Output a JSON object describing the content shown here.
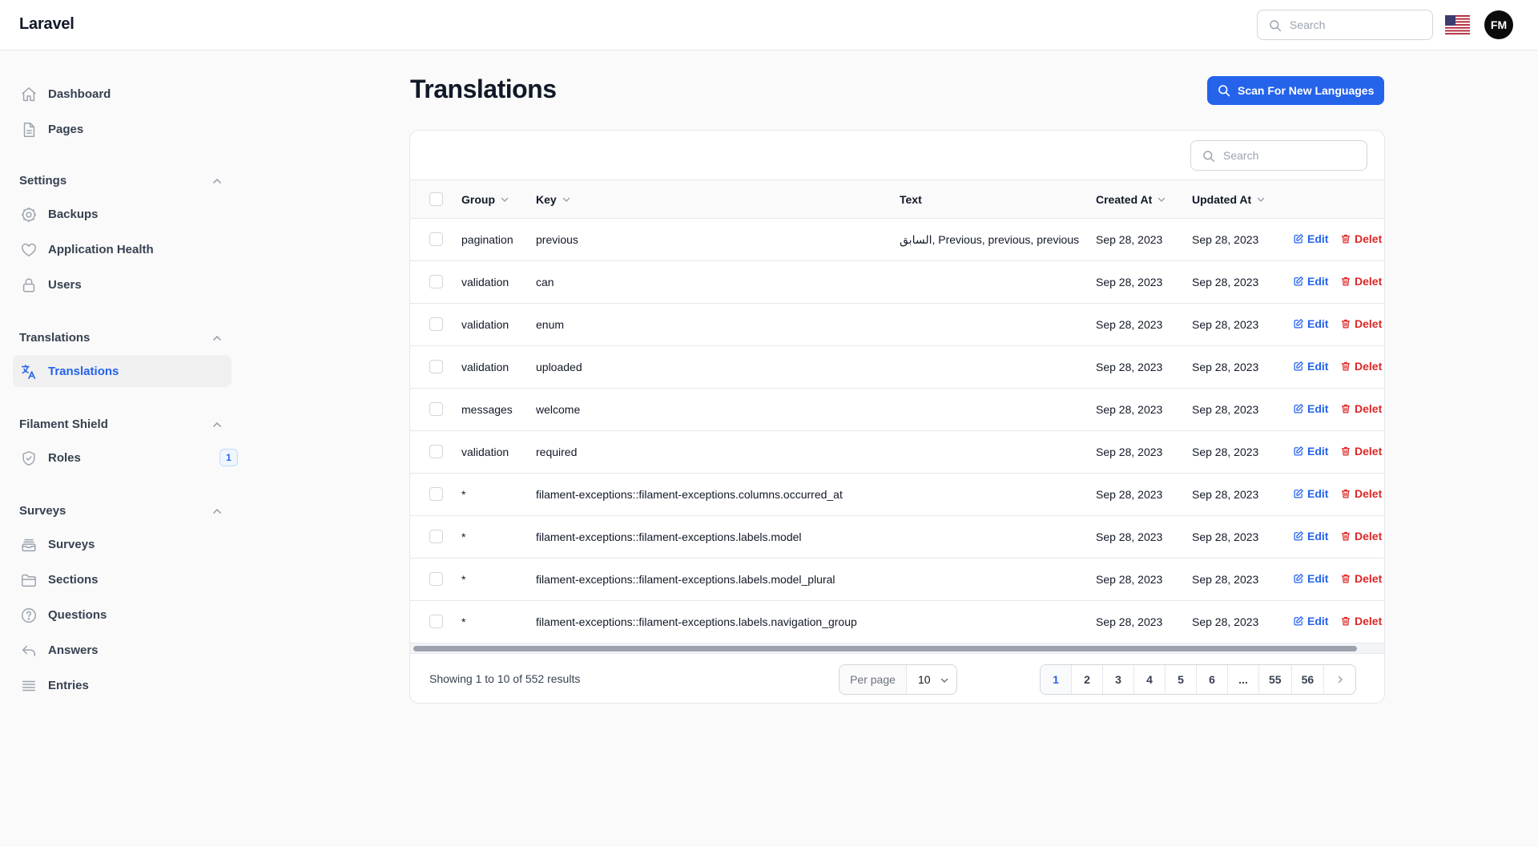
{
  "app": {
    "brand": "Laravel"
  },
  "topbar": {
    "search_placeholder": "Search",
    "avatar_initials": "FM"
  },
  "sidebar": {
    "items_top": [
      {
        "label": "Dashboard",
        "icon": "home-icon"
      },
      {
        "label": "Pages",
        "icon": "document-icon"
      }
    ],
    "groups": [
      {
        "label": "Settings",
        "items": [
          {
            "label": "Backups",
            "icon": "cog-icon"
          },
          {
            "label": "Application Health",
            "icon": "heart-icon"
          },
          {
            "label": "Users",
            "icon": "lock-icon"
          }
        ]
      },
      {
        "label": "Translations",
        "items": [
          {
            "label": "Translations",
            "icon": "language-icon",
            "active": true
          }
        ]
      },
      {
        "label": "Filament Shield",
        "items": [
          {
            "label": "Roles",
            "icon": "shield-check-icon",
            "badge": "1"
          }
        ]
      },
      {
        "label": "Surveys",
        "items": [
          {
            "label": "Surveys",
            "icon": "inbox-stack-icon"
          },
          {
            "label": "Sections",
            "icon": "folder-icon"
          },
          {
            "label": "Questions",
            "icon": "question-circle-icon"
          },
          {
            "label": "Answers",
            "icon": "reply-arrow-icon"
          },
          {
            "label": "Entries",
            "icon": "bars-icon"
          }
        ]
      }
    ]
  },
  "main": {
    "title": "Translations",
    "scan_button": "Scan For New Languages",
    "table": {
      "search_placeholder": "Search",
      "columns": {
        "group": "Group",
        "key": "Key",
        "text": "Text",
        "created_at": "Created At",
        "updated_at": "Updated At"
      },
      "actions": {
        "edit": "Edit",
        "delete": "Delet"
      },
      "rows": [
        {
          "group": "pagination",
          "key": "previous",
          "text": "السابق, Previous, previous, previous",
          "created_at": "Sep 28, 2023",
          "updated_at": "Sep 28, 2023"
        },
        {
          "group": "validation",
          "key": "can",
          "text": "",
          "created_at": "Sep 28, 2023",
          "updated_at": "Sep 28, 2023"
        },
        {
          "group": "validation",
          "key": "enum",
          "text": "",
          "created_at": "Sep 28, 2023",
          "updated_at": "Sep 28, 2023"
        },
        {
          "group": "validation",
          "key": "uploaded",
          "text": "",
          "created_at": "Sep 28, 2023",
          "updated_at": "Sep 28, 2023"
        },
        {
          "group": "messages",
          "key": "welcome",
          "text": "",
          "created_at": "Sep 28, 2023",
          "updated_at": "Sep 28, 2023"
        },
        {
          "group": "validation",
          "key": "required",
          "text": "",
          "created_at": "Sep 28, 2023",
          "updated_at": "Sep 28, 2023"
        },
        {
          "group": "*",
          "key": "filament-exceptions::filament-exceptions.columns.occurred_at",
          "text": "",
          "created_at": "Sep 28, 2023",
          "updated_at": "Sep 28, 2023"
        },
        {
          "group": "*",
          "key": "filament-exceptions::filament-exceptions.labels.model",
          "text": "",
          "created_at": "Sep 28, 2023",
          "updated_at": "Sep 28, 2023"
        },
        {
          "group": "*",
          "key": "filament-exceptions::filament-exceptions.labels.model_plural",
          "text": "",
          "created_at": "Sep 28, 2023",
          "updated_at": "Sep 28, 2023"
        },
        {
          "group": "*",
          "key": "filament-exceptions::filament-exceptions.labels.navigation_group",
          "text": "",
          "created_at": "Sep 28, 2023",
          "updated_at": "Sep 28, 2023"
        }
      ]
    },
    "footer": {
      "showing": "Showing 1 to 10 of 552 results",
      "per_page_label": "Per page",
      "per_page_value": "10",
      "pages": [
        "1",
        "2",
        "3",
        "4",
        "5",
        "6",
        "...",
        "55",
        "56"
      ],
      "current_page": "1"
    }
  },
  "colors": {
    "primary": "#2563eb",
    "danger": "#dc2626",
    "border": "#e5e7eb"
  }
}
